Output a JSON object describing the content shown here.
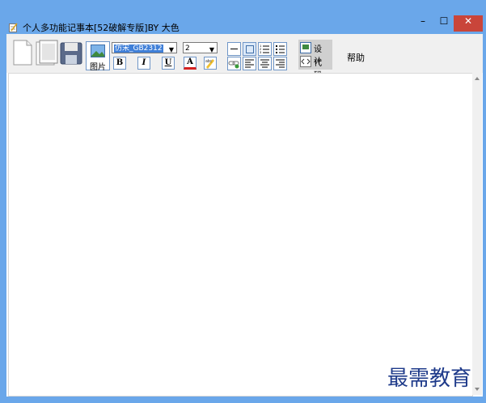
{
  "window": {
    "title": "个人多功能记事本[52破解专版]BY   大色",
    "controls": {
      "minimize": "–",
      "maximize": "☐",
      "close": "✕"
    }
  },
  "toolbar": {
    "picture_label": "图片",
    "font_value": "仿宋_GB2312",
    "size_value": "2",
    "bold": "B",
    "italic": "I",
    "underline": "U",
    "font_color": "A",
    "design_label": "设计",
    "code_label": "代码",
    "help_label": "帮助"
  },
  "watermark": "最需教育",
  "colors": {
    "titlebar": "#6aa7ea",
    "close": "#c9453a",
    "accent": "#3f7fd8"
  }
}
